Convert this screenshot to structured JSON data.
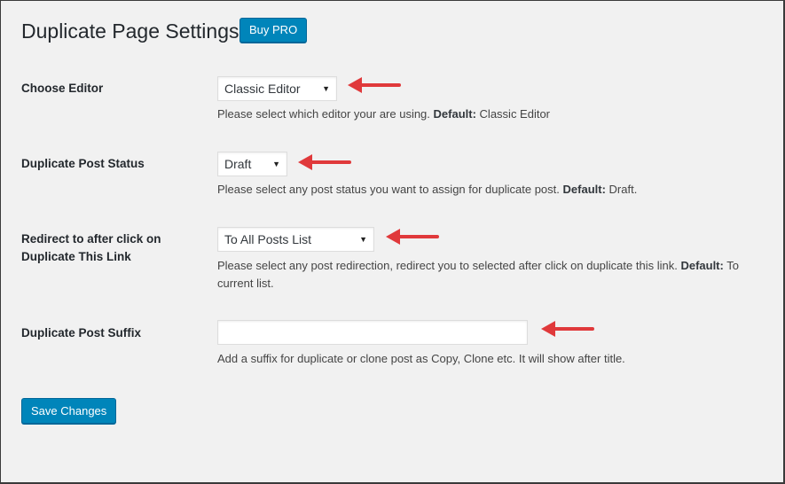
{
  "page_title": "Duplicate Page Settings",
  "buy_pro_label": "Buy PRO",
  "colors": {
    "accent": "#0085ba",
    "arrow": "#e0393b"
  },
  "settings": [
    {
      "label": "Choose Editor",
      "selected": "Classic Editor",
      "desc_text": "Please select which editor your are using.",
      "desc_default_label": "Default:",
      "desc_default_value": "Classic Editor"
    },
    {
      "label": "Duplicate Post Status",
      "selected": "Draft",
      "desc_text": "Please select any post status you want to assign for duplicate post.",
      "desc_default_label": "Default:",
      "desc_default_value": "Draft."
    },
    {
      "label_line1": "Redirect to after click on",
      "label_line2": "Duplicate This Link",
      "selected": "To All Posts List",
      "desc_text": "Please select any post redirection, redirect you to selected after click on duplicate this link.",
      "desc_default_label": "Default:",
      "desc_default_value": "To current list."
    },
    {
      "label": "Duplicate Post Suffix",
      "value": "",
      "desc_text": "Add a suffix for duplicate or clone post as Copy, Clone etc. It will show after title."
    }
  ],
  "save_label": "Save Changes",
  "icons": {
    "dropdown": "triangle-down-icon",
    "annotation": "red-arrow-left-icon"
  }
}
